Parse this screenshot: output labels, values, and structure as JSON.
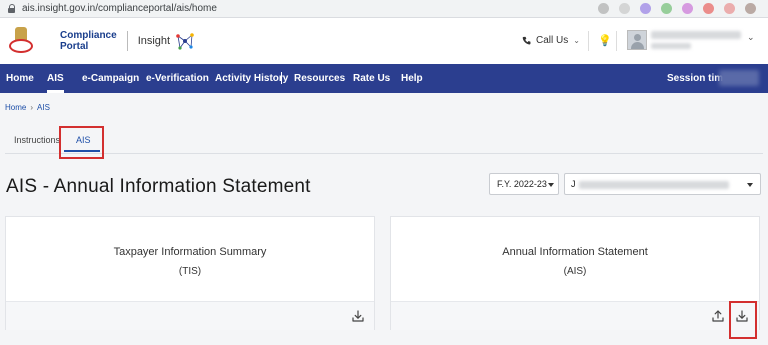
{
  "browser": {
    "url": "ais.insight.gov.in/complianceportal/ais/home"
  },
  "header": {
    "portal_line1": "Compliance",
    "portal_line2": "Portal",
    "insight_label": "Insight",
    "call_us": "Call Us"
  },
  "nav": {
    "items": [
      "Home",
      "AIS",
      "e-Campaign",
      "e-Verification",
      "Activity History",
      "Resources",
      "Rate Us",
      "Help"
    ],
    "active": "AIS",
    "session_label": "Session time"
  },
  "breadcrumb": {
    "home": "Home",
    "current": "AIS"
  },
  "tabs": {
    "items": [
      "Instructions",
      "AIS"
    ],
    "active": "AIS"
  },
  "page": {
    "title": "AIS - Annual Information Statement",
    "fy_select": "F.Y. 2022-23",
    "pan_select_prefix": "J"
  },
  "cards": [
    {
      "title": "Taxpayer Information Summary",
      "subtitle": "(TIS)",
      "actions": [
        "download-icon"
      ]
    },
    {
      "title": "Annual Information Statement",
      "subtitle": "(AIS)",
      "actions": [
        "upload-icon",
        "download-icon"
      ]
    }
  ],
  "colors": {
    "nav_bg": "#2b3e8f",
    "accent": "#1e4fa8",
    "highlight": "#d32f2f"
  }
}
